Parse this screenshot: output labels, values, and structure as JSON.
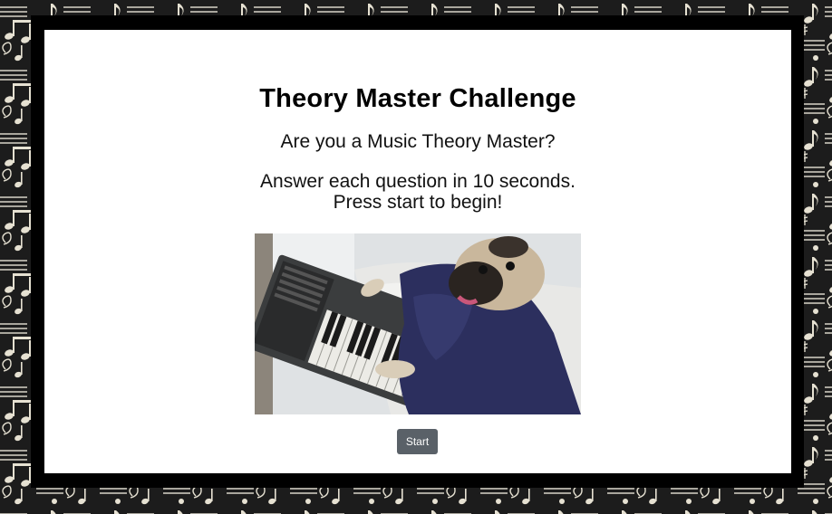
{
  "page": {
    "title": "Theory Master Challenge",
    "question": "Are you a Music Theory Master?",
    "instructions_line1": "Answer each question in 10 seconds.",
    "instructions_line2": "Press start to begin!"
  },
  "start_button": {
    "label": "Start"
  },
  "image": {
    "subject": "pug-playing-keyboard"
  },
  "colors": {
    "background_pattern": "#1a1a1a",
    "frame": "#000000",
    "card": "#ffffff",
    "button": "#5a6168"
  }
}
